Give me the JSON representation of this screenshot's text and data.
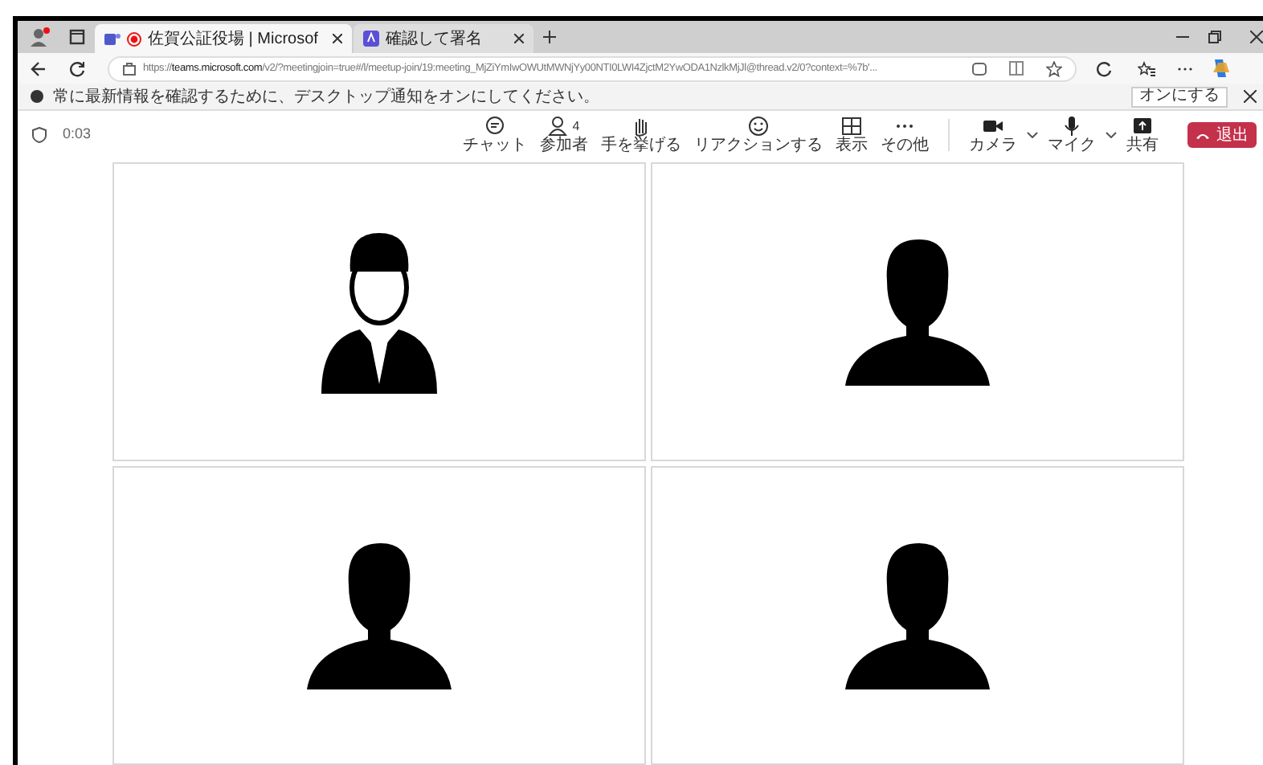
{
  "browser": {
    "tabs": [
      {
        "kind": "teams",
        "title": "佐賀公証役場 | Microsof",
        "recording": true,
        "selected": true
      },
      {
        "kind": "pdf",
        "title": "確認して署名",
        "recording": false,
        "selected": false
      }
    ],
    "url": "https://**teams.microsoft.com**/v2/?meetingjoin=true#/l/meetup-join/19:meeting_MjZiYmIwOWUtMWNjYy00NTI0LWI4ZjctM2YwODA1NzlkMjJl@thread.v2/0?context=%7b'..."
  },
  "notification": {
    "message": "常に最新情報を確認するために、デスクトップ通知をオンにしてください。",
    "button": "オンにする"
  },
  "meeting": {
    "timer": "0:03",
    "toolbar": [
      {
        "kind": "chat",
        "label": "チャット"
      },
      {
        "kind": "people",
        "label": "参加者",
        "badge": "4"
      },
      {
        "kind": "hand",
        "label": "手を挙げる"
      },
      {
        "kind": "react",
        "label": "リアクションする"
      },
      {
        "kind": "view",
        "label": "表示"
      },
      {
        "kind": "more",
        "label": "その他"
      },
      {
        "kind": "camera",
        "label": "カメラ"
      },
      {
        "kind": "mic",
        "label": "マイク"
      },
      {
        "kind": "share",
        "label": "共有"
      }
    ],
    "leave": "退出",
    "tiles": [
      {
        "kind": "outline"
      },
      {
        "kind": "silhouette"
      },
      {
        "kind": "silhouette"
      },
      {
        "kind": "silhouette"
      }
    ]
  }
}
